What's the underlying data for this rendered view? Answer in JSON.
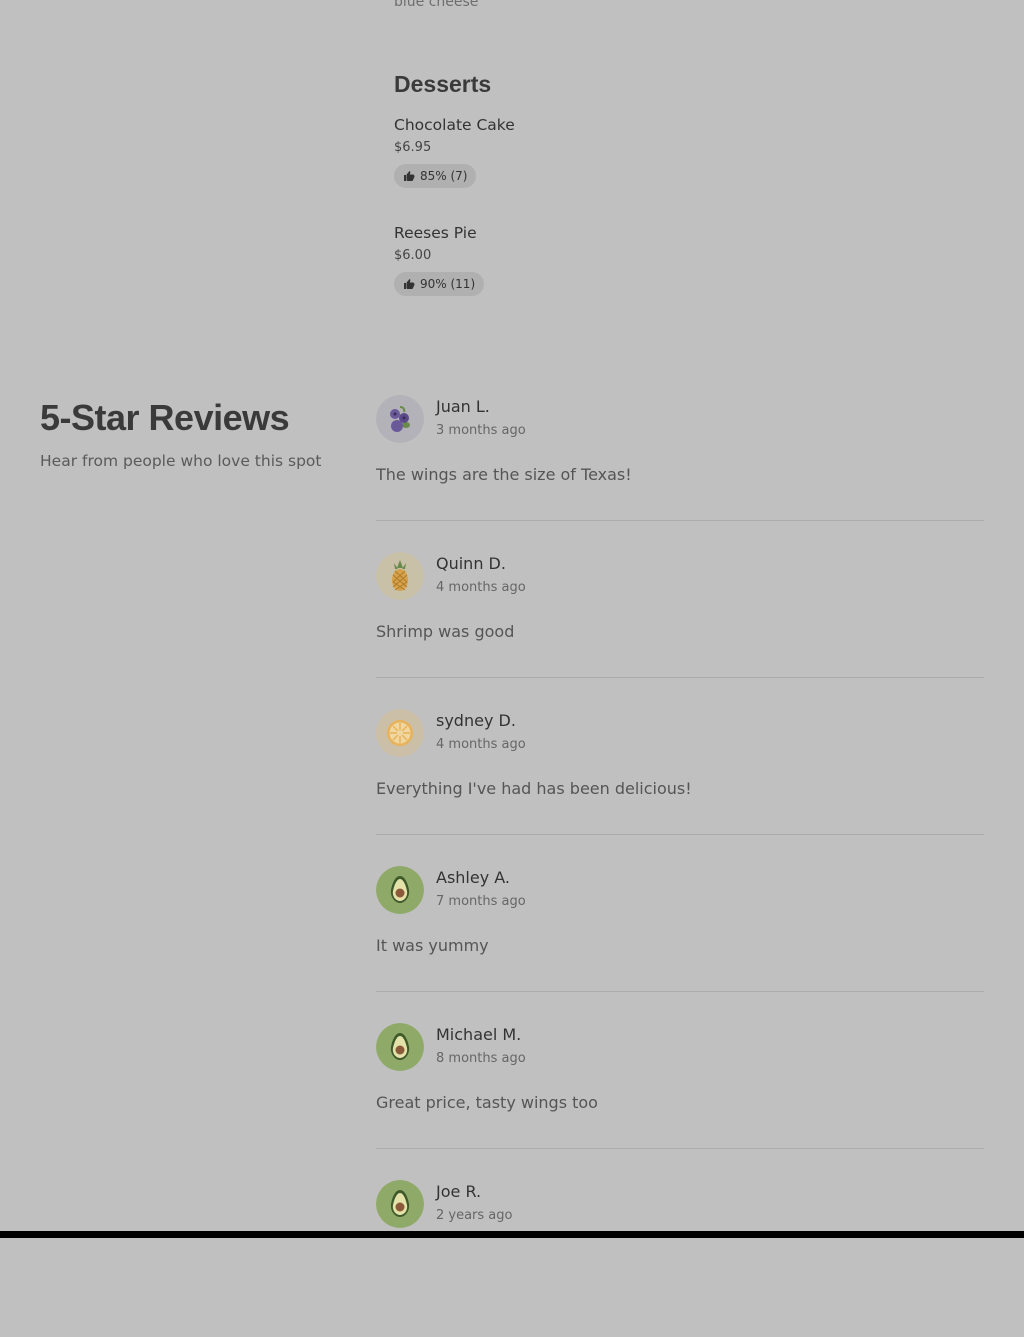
{
  "menu": {
    "cut_text": "blue cheese",
    "category_title": "Desserts",
    "items": [
      {
        "name": "Chocolate Cake",
        "price": "$6.95",
        "rating": "85% (7)"
      },
      {
        "name": "Reeses Pie",
        "price": "$6.00",
        "rating": "90% (11)"
      }
    ]
  },
  "reviews_section": {
    "title": "5-Star Reviews",
    "subtitle": "Hear from people who love this spot"
  },
  "reviews": [
    {
      "name": "Juan L.",
      "date": "3 months ago",
      "text": "The wings are the size of Texas!",
      "avatar": "blueberry-icon"
    },
    {
      "name": "Quinn D.",
      "date": "4 months ago",
      "text": "Shrimp was good",
      "avatar": "pineapple-icon"
    },
    {
      "name": "sydney D.",
      "date": "4 months ago",
      "text": "Everything I've had has been delicious!",
      "avatar": "orange-slice-icon"
    },
    {
      "name": "Ashley A.",
      "date": "7 months ago",
      "text": "It was yummy",
      "avatar": "avocado-icon"
    },
    {
      "name": "Michael M.",
      "date": "8 months ago",
      "text": "Great price, tasty wings too",
      "avatar": "avocado-icon"
    },
    {
      "name": "Joe R.",
      "date": "2 years ago",
      "text": "",
      "avatar": "avocado-icon"
    }
  ],
  "colors": {
    "overlay_bg": "#c0c0c0",
    "pill_bg": "#b0b0b0",
    "avocado": "#8faa68"
  }
}
